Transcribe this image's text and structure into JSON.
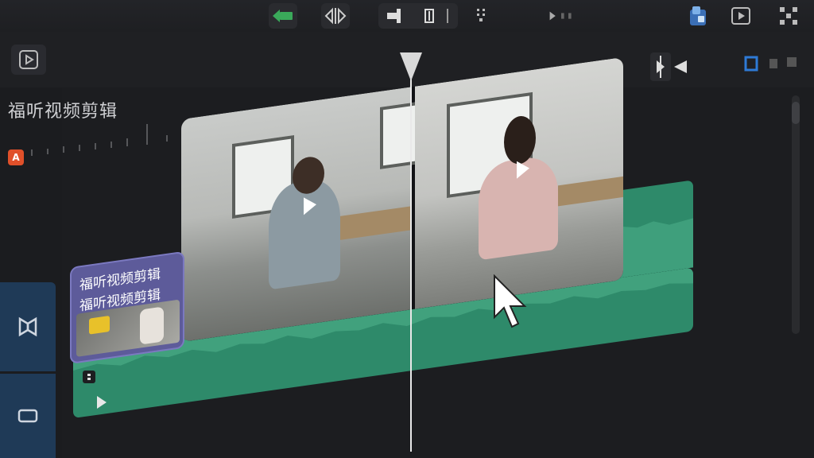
{
  "project": {
    "title": "福听视频剪辑"
  },
  "badge": {
    "label": "A"
  },
  "title_clip": {
    "line1": "福听视频剪辑",
    "line2": "福听视频剪辑"
  },
  "colors": {
    "accent_green": "#3aa95a",
    "audio_track": "#2e8a6a",
    "title_clip": "#5d5b9a",
    "track_side": "#1f3a57",
    "badge": "#e0502a"
  },
  "icons": {
    "toolbar": [
      "back-arrow-icon",
      "split-icon",
      "trim-icon",
      "marker-icon",
      "grid-icon",
      "play-forward-icon",
      "layers-icon",
      "preview-icon",
      "fullscreen-icon"
    ],
    "row2": [
      "preview-play-icon",
      "play-marker-icon",
      "rewind-icon",
      "loop-icon"
    ],
    "tracks": [
      "video-track-icon",
      "audio-track-icon"
    ]
  }
}
